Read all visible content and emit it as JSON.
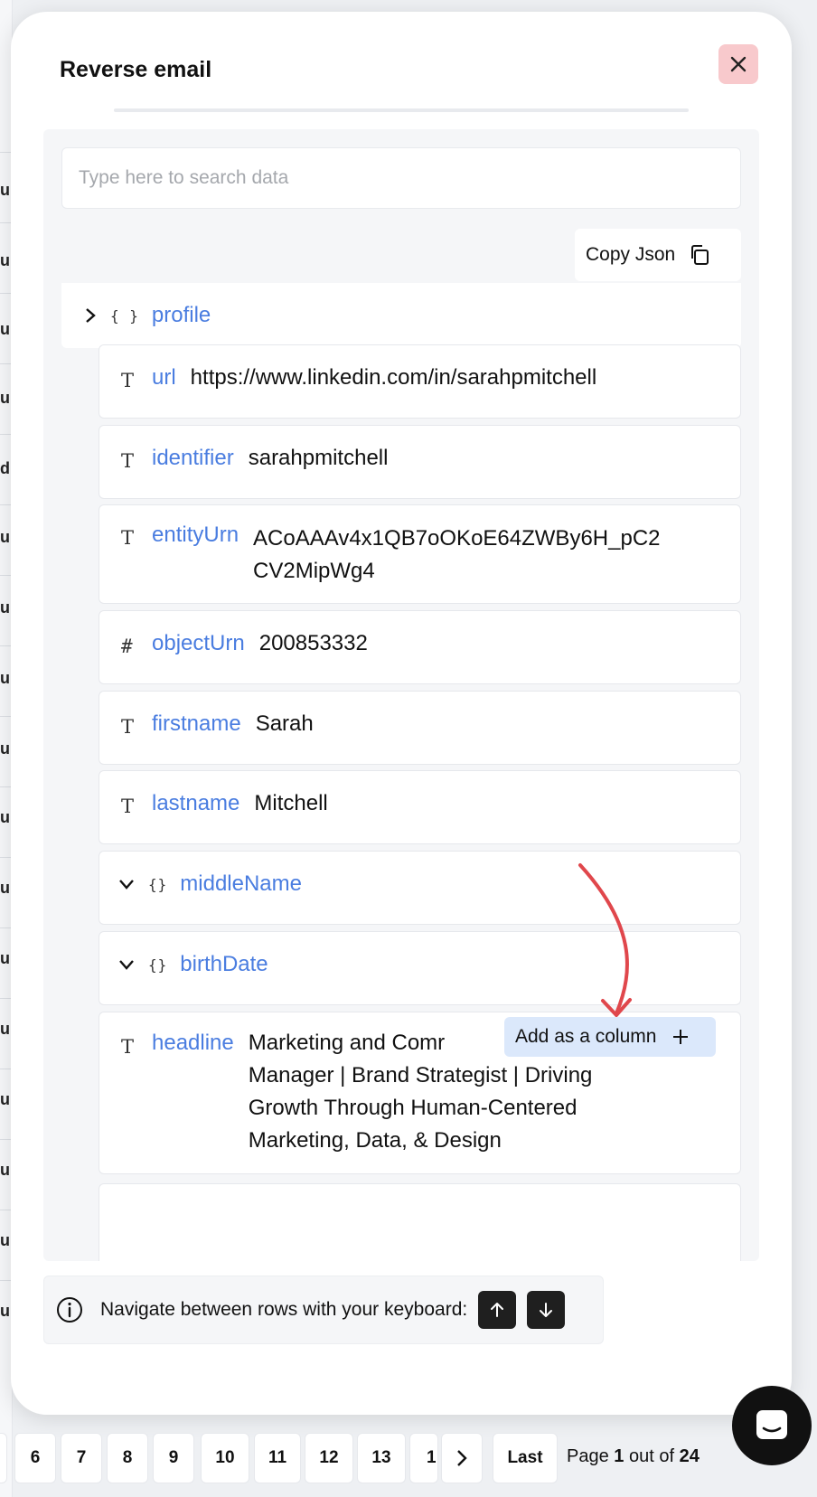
{
  "modal": {
    "title": "Reverse email",
    "search_placeholder": "Type here to search data",
    "copy_json_label": "Copy Json",
    "root_key": "profile"
  },
  "fields": [
    {
      "type": "T",
      "key": "url",
      "value": "https://www.linkedin.com/in/sarahpmitchell"
    },
    {
      "type": "T",
      "key": "identifier",
      "value": "sarahpmitchell"
    },
    {
      "type": "T",
      "key": "entityUrn",
      "value_line1": "ACoAAAv4x1QB7oOKoE64ZWBy6H_pC2",
      "value_line2": "CV2MipWg4"
    },
    {
      "type": "#",
      "key": "objectUrn",
      "value": "200853332"
    },
    {
      "type": "T",
      "key": "firstname",
      "value": "Sarah"
    },
    {
      "type": "T",
      "key": "lastname",
      "value": "Mitchell"
    },
    {
      "type": "{}",
      "key": "middleName"
    },
    {
      "type": "{}",
      "key": "birthDate"
    },
    {
      "type": "T",
      "key": "headline",
      "value_line1": "Marketing and Comr",
      "value_line2": "Manager | Brand Strategist | Driving",
      "value_line3": "Growth Through Human-Centered",
      "value_line4": "Marketing, Data, & Design"
    }
  ],
  "add_column_label": "Add as a column",
  "nav_hint": "Navigate between rows with your keyboard:",
  "pagination": {
    "pages": [
      "6",
      "7",
      "8",
      "9",
      "10",
      "11",
      "12",
      "13",
      "1"
    ],
    "last_label": "Last",
    "page_prefix": "Page",
    "current": "1",
    "out_of": "out of",
    "total": "24"
  },
  "colors": {
    "key": "#4a7de0",
    "close_bg": "#f8c9cc",
    "add_column_bg": "#dbe8fb",
    "arrow": "#e0474c"
  }
}
